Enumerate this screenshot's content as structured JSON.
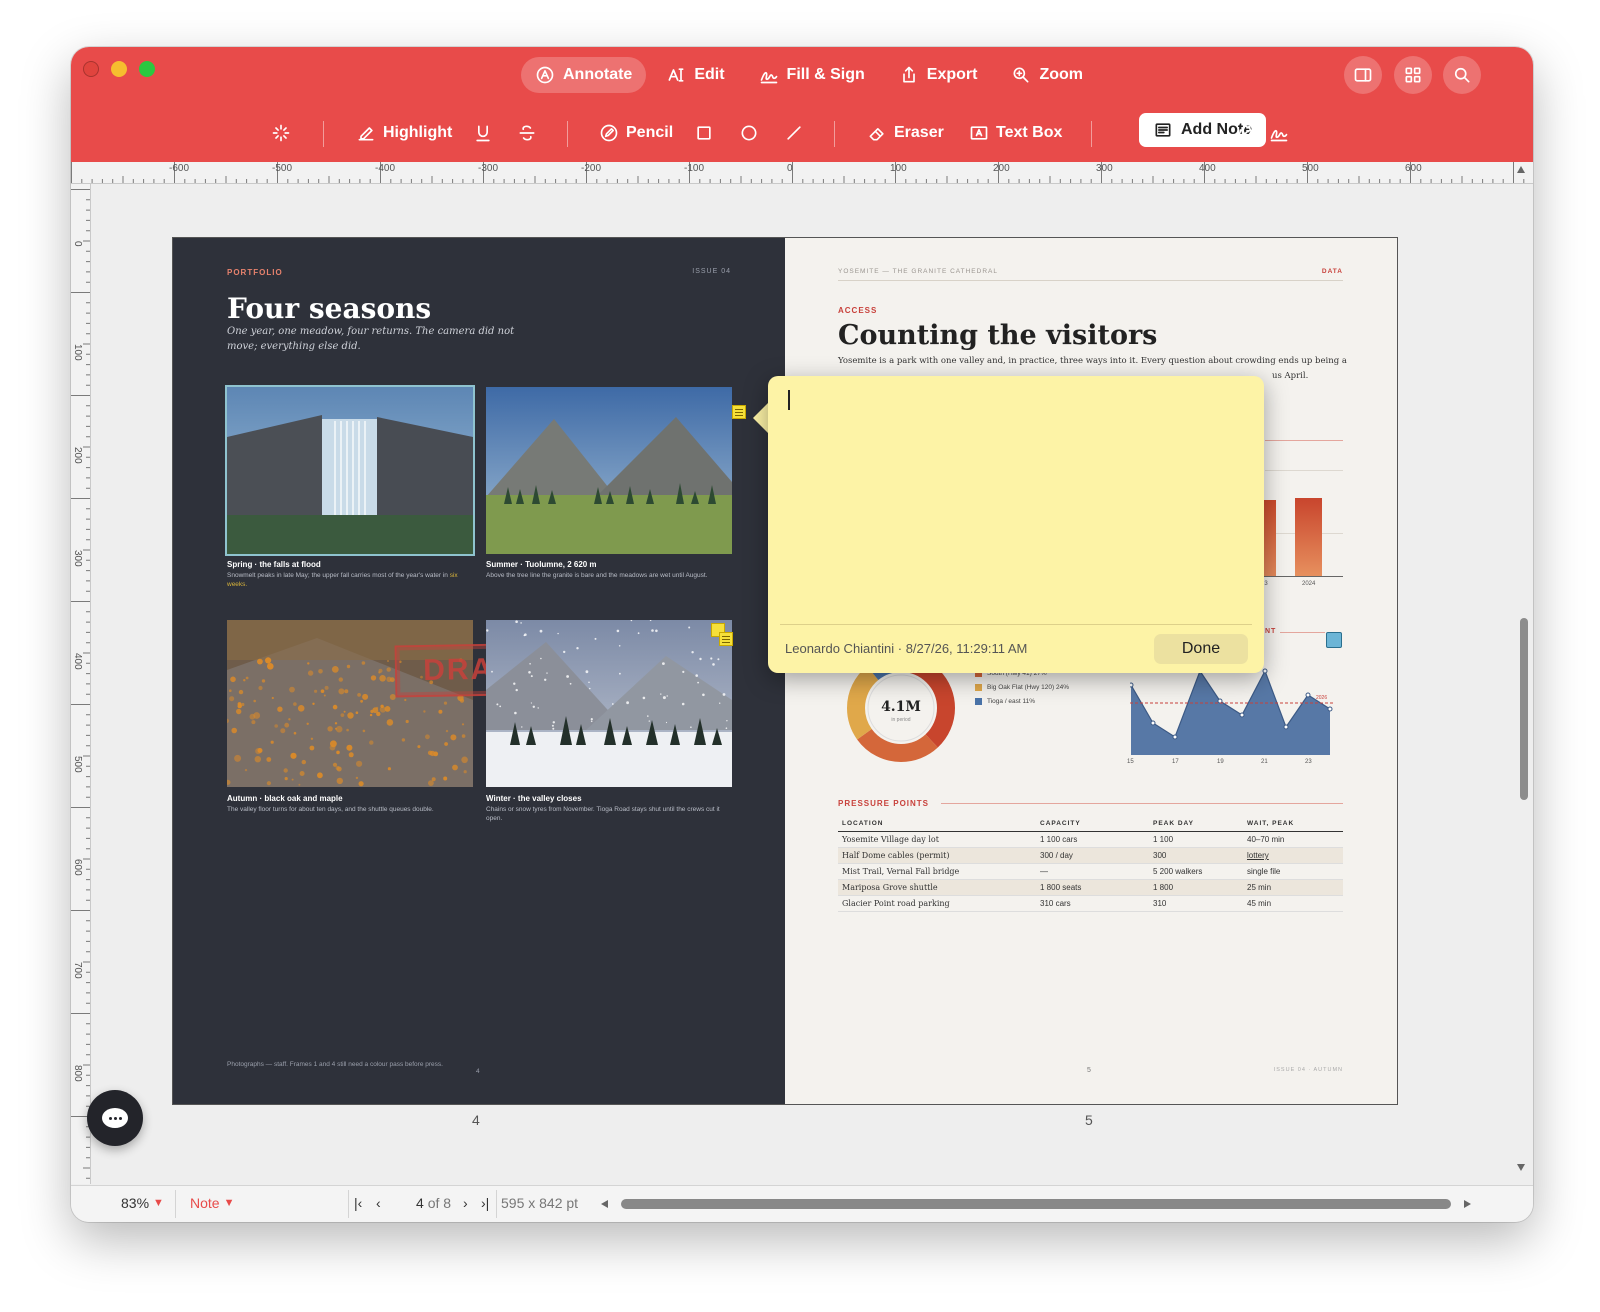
{
  "toolbar": {
    "tabs": [
      {
        "label": "Annotate",
        "icon": "annotate-icon",
        "active": true
      },
      {
        "label": "Edit",
        "icon": "text-cursor-icon"
      },
      {
        "label": "Fill & Sign",
        "icon": "signature-icon"
      },
      {
        "label": "Export",
        "icon": "share-icon"
      },
      {
        "label": "Zoom",
        "icon": "zoom-icon"
      }
    ],
    "tools": {
      "highlight": "Highlight",
      "pencil": "Pencil",
      "eraser": "Eraser",
      "text_box": "Text Box",
      "add_note": "Add Note"
    }
  },
  "ruler": {
    "h_labels": [
      "-600",
      "-500",
      "-400",
      "-300",
      "-200",
      "-100",
      "0",
      "100",
      "200",
      "300",
      "400",
      "500",
      "600"
    ],
    "v_labels": [
      "0",
      "100",
      "200",
      "300",
      "400",
      "500",
      "600",
      "700",
      "800"
    ]
  },
  "page_left": {
    "section": "PORTFOLIO",
    "issue": "ISSUE 04",
    "title": "Four seasons",
    "subtitle": "One year, one meadow, four returns. The camera did not move; everything else did.",
    "photos": [
      {
        "caption": "Spring · the falls at flood",
        "text": "Snowmelt peaks in late May; the upper fall carries most of the year's water in",
        "highlight": "six weeks."
      },
      {
        "caption": "Summer · Tuolumne, 2 620 m",
        "text": "Above the tree line the granite is bare and the meadows are wet until August."
      },
      {
        "caption": "Autumn · black oak and maple",
        "text": "The valley floor turns for about ten days, and the shuttle queues double."
      },
      {
        "caption": "Winter · the valley closes",
        "text": "Chains or snow tyres from November. Tioga Road stays shut until the crews cut it open."
      }
    ],
    "stamp": "DRAFT",
    "footer": "Photographs — staff. Frames 1 and 4 still need a colour pass before press.",
    "page_num": "4"
  },
  "page_right": {
    "header_left": "YOSEMITE — THE GRANITE CATHEDRAL",
    "header_right": "DATA",
    "section": "ACCESS",
    "title": "Counting the visitors",
    "body": "Yosemite is a park with one valley and, in practice, three ways into it. Every question about crowding ends up being a",
    "body2": "us April.",
    "donut": {
      "value": "4.1M",
      "sub": "in period"
    },
    "legend": [
      {
        "label": "South (Hwy 41) 27%",
        "color": "#d4673a"
      },
      {
        "label": "Big Oak Flat (Hwy 120) 24%",
        "color": "#e0a84a"
      },
      {
        "label": "Tioga / east 11%",
        "color": "#4a73a8"
      }
    ],
    "bar_year": "2024",
    "bar_prev": "23",
    "area_x": [
      "15",
      "17",
      "19",
      "21",
      "23"
    ],
    "area_ref": "2026",
    "section_label2": "NT",
    "table_title": "PRESSURE POINTS",
    "table_headers": [
      "LOCATION",
      "CAPACITY",
      "PEAK DAY",
      "WAIT, PEAK"
    ],
    "table_rows": [
      [
        "Yosemite Village day lot",
        "1 100 cars",
        "1 100",
        "40–70 min"
      ],
      [
        "Half Dome cables (permit)",
        "300 / day",
        "300",
        "lottery"
      ],
      [
        "Mist Trail, Vernal Fall bridge",
        "—",
        "5 200 walkers",
        "single file"
      ],
      [
        "Mariposa Grove shuttle",
        "1 800 seats",
        "1 800",
        "25 min"
      ],
      [
        "Glacier Point road parking",
        "310 cars",
        "310",
        "45 min"
      ]
    ],
    "page_num": "5",
    "footer_right": "ISSUE 04 · AUTUMN"
  },
  "page_labels": [
    "4",
    "5"
  ],
  "note": {
    "author_time": "Leonardo Chiantini · 8/27/26, 11:29:11 AM",
    "done_label": "Done",
    "value": ""
  },
  "status": {
    "zoom": "83%",
    "mode": "Note",
    "page_current": "4",
    "page_of": "of 8",
    "page_size": "595 x 842 pt"
  },
  "colors": {
    "accent": "#e84b4a",
    "note": "#fdf3a6",
    "page_dark": "#2e313a",
    "page_light": "#f4f2ee"
  }
}
